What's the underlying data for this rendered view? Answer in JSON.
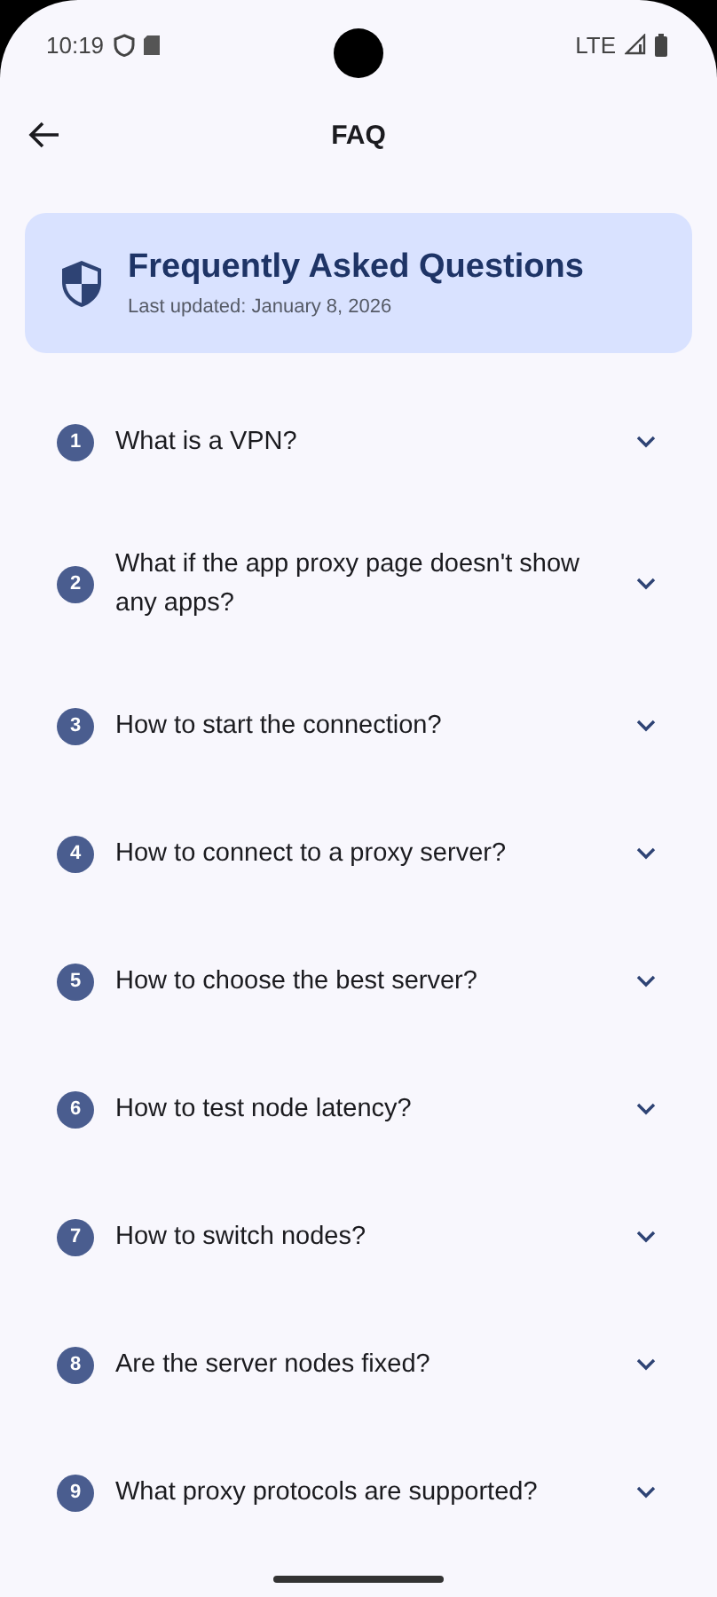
{
  "status_bar": {
    "time": "10:19",
    "network": "LTE"
  },
  "app_bar": {
    "title": "FAQ"
  },
  "header_card": {
    "title": "Frequently Asked Questions",
    "subtitle": "Last updated: January 8, 2026"
  },
  "questions": [
    {
      "number": "1",
      "text": "What is a VPN?",
      "expanded": false
    },
    {
      "number": "2",
      "text": "What if the app proxy page doesn't show any apps?",
      "expanded": false
    },
    {
      "number": "3",
      "text": "How to start the connection?",
      "expanded": false
    },
    {
      "number": "4",
      "text": "How to connect to a proxy server?",
      "expanded": false
    },
    {
      "number": "5",
      "text": "How to choose the best server?",
      "expanded": false
    },
    {
      "number": "6",
      "text": "How to test node latency?",
      "expanded": false
    },
    {
      "number": "7",
      "text": "How to switch nodes?",
      "expanded": false
    },
    {
      "number": "8",
      "text": "Are the server nodes fixed?",
      "expanded": false
    },
    {
      "number": "9",
      "text": "What proxy protocols are supported?",
      "expanded": false
    }
  ]
}
